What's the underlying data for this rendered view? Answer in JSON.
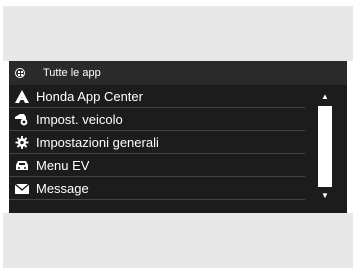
{
  "header": {
    "title": "Tutte le app",
    "icon": "apps-grid-icon"
  },
  "list": {
    "items": [
      {
        "label": "Honda App Center",
        "icon": "honda-app-center-icon"
      },
      {
        "label": "Impost. veicolo",
        "icon": "vehicle-settings-icon"
      },
      {
        "label": "Impostazioni generali",
        "icon": "gear-icon"
      },
      {
        "label": "Menu EV",
        "icon": "ev-car-icon"
      },
      {
        "label": "Message",
        "icon": "envelope-icon"
      }
    ]
  },
  "scrollbar": {
    "up_icon": "scroll-up-icon",
    "down_icon": "scroll-down-icon",
    "thumb_position": 0.4
  },
  "colors": {
    "screen_background": "#1c1c1c",
    "header_background": "#2a2a2a",
    "text": "#ffffff",
    "device_bezel": "#e8e8e8"
  }
}
